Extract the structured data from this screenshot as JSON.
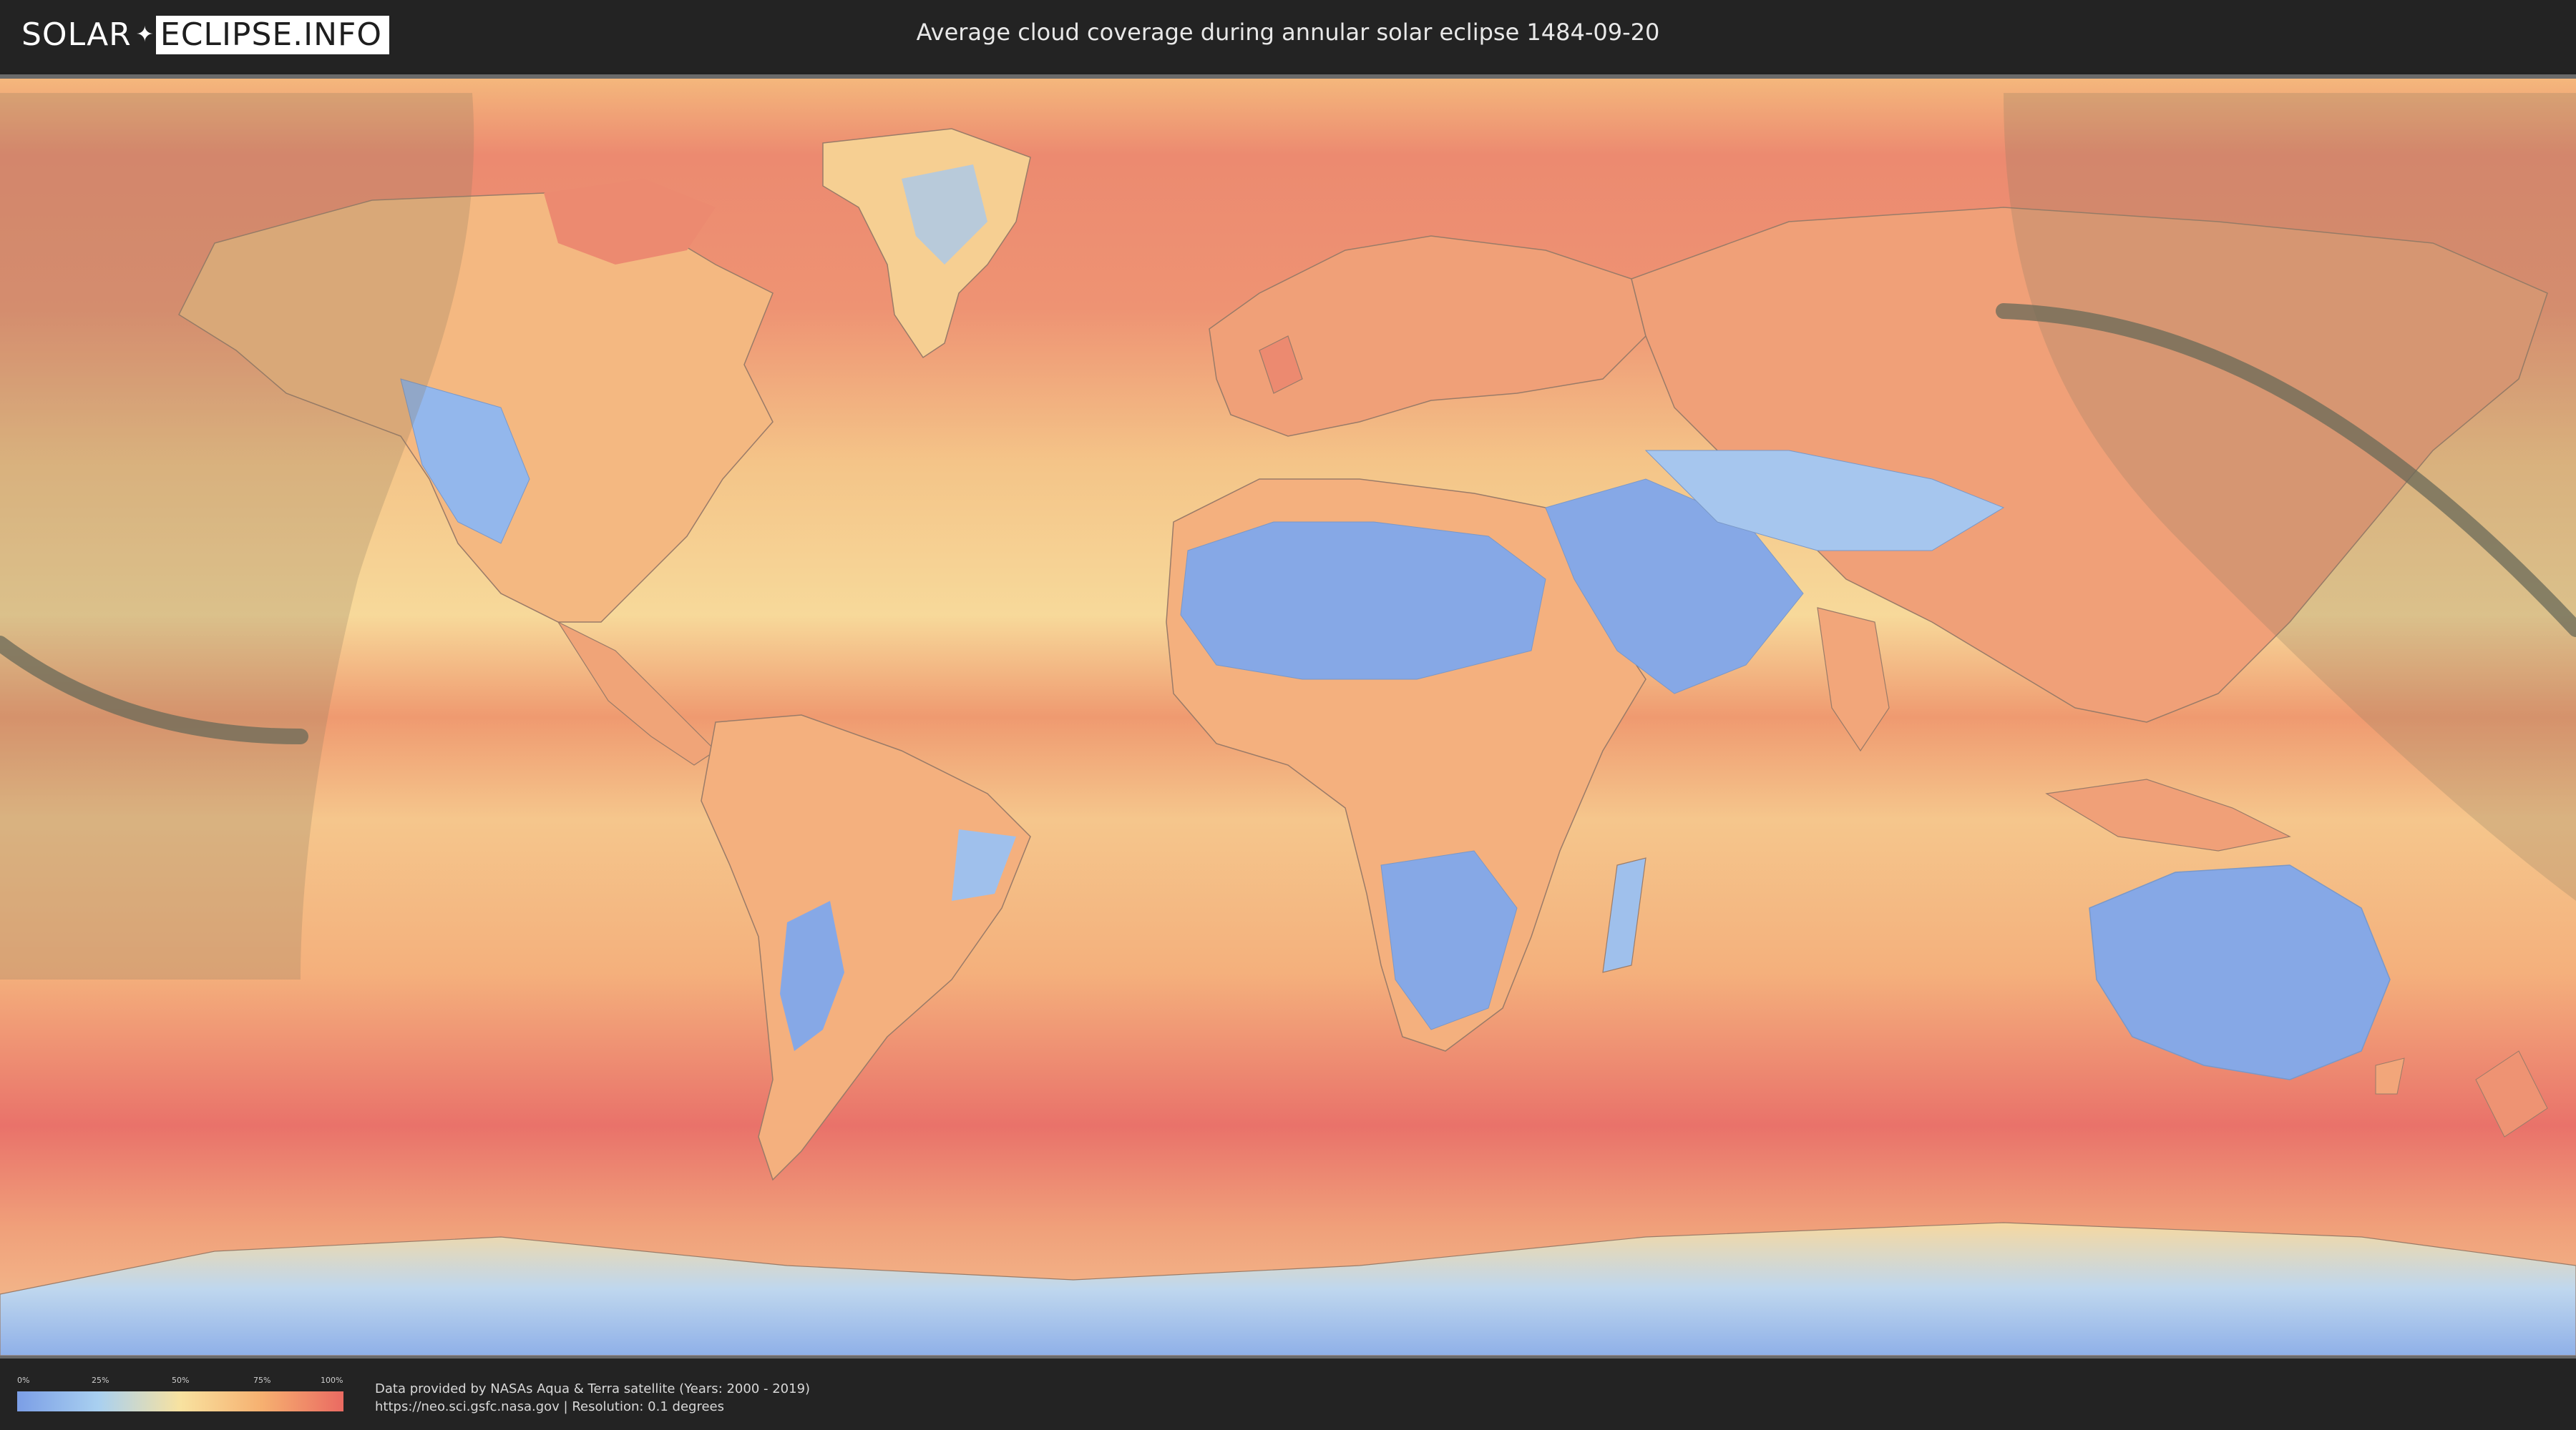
{
  "header": {
    "logo_part1": "SOLAR",
    "logo_part2": "ECLIPSE.INFO",
    "title": "Average cloud coverage during annular solar eclipse 1484-09-20"
  },
  "legend": {
    "ticks": [
      "0%",
      "25%",
      "50%",
      "75%",
      "100%"
    ],
    "colors": [
      "#7b9ee6",
      "#a9d0f0",
      "#f8e2a0",
      "#f6b070",
      "#ea6a62"
    ]
  },
  "credits": {
    "line1": "Data provided by NASAs Aqua & Terra satellite (Years: 2000 - 2019)",
    "line2": "https://neo.sci.gsfc.nasa.gov | Resolution: 0.1 degrees"
  },
  "map": {
    "ocean_color": "#f2a06c",
    "dry_color": "#86a8e6",
    "shadow_color": "#8a7a60"
  }
}
